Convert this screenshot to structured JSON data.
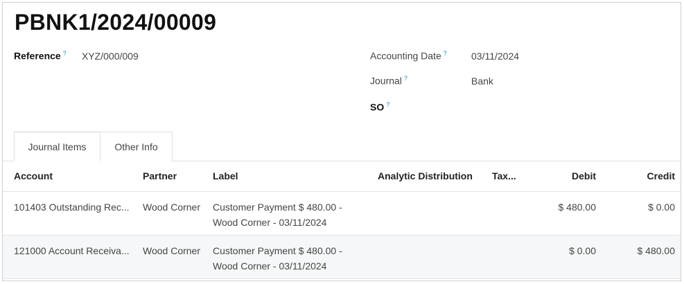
{
  "record": {
    "title": "PBNK1/2024/00009",
    "reference_label": "Reference",
    "reference_value": "XYZ/000/009",
    "accounting_date_label": "Accounting Date",
    "accounting_date_value": "03/11/2024",
    "journal_label": "Journal",
    "journal_value": "Bank",
    "so_label": "SO",
    "help_marker": "?"
  },
  "tabs": [
    {
      "label": "Journal Items",
      "active": true
    },
    {
      "label": "Other Info",
      "active": false
    }
  ],
  "table": {
    "columns": [
      "Account",
      "Partner",
      "Label",
      "Analytic Distribution",
      "Tax...",
      "Debit",
      "Credit"
    ],
    "rows": [
      {
        "account": "101403 Outstanding Rec...",
        "partner": "Wood Corner",
        "label_line1": "Customer Payment $ 480.00 -",
        "label_line2": "Wood Corner - 03/11/2024",
        "debit": "$ 480.00",
        "credit": "$ 0.00"
      },
      {
        "account": "121000 Account Receiva...",
        "partner": "Wood Corner",
        "label_line1": "Customer Payment $ 480.00 -",
        "label_line2": "Wood Corner - 03/11/2024",
        "debit": "$ 0.00",
        "credit": "$ 480.00"
      }
    ]
  }
}
